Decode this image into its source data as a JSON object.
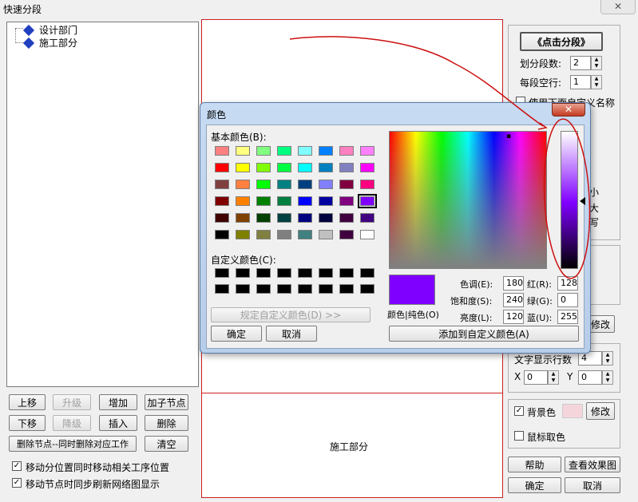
{
  "window": {
    "title": "快速分段"
  },
  "tree": {
    "items": [
      "设计部门",
      "施工部分"
    ]
  },
  "left_buttons": {
    "up": "上移",
    "promote": "升级",
    "add": "增加",
    "add_child": "加子节点",
    "down": "下移",
    "demote": "降级",
    "insert": "插入",
    "delete": "删除",
    "delete_node": "删除节点--同时删除对应工作",
    "clear": "清空"
  },
  "left_checks": {
    "move_pos": "移动分位置同时移动相关工序位置",
    "refresh": "移动节点时同步刷新网络图显示"
  },
  "center": {
    "bottom_label": "施工部分"
  },
  "right": {
    "click_segment": "《点击分段》",
    "seg_count_label": "划分段数:",
    "seg_count": "2",
    "blank_rows_label": "每段空行:",
    "blank_rows": "1",
    "use_custom_name": "使用下面自定义名称",
    "modify_partial": "修改",
    "text_rows_label": "文字显示行数",
    "text_rows": "4",
    "x_label": "X",
    "x_val": "0",
    "y_label": "Y",
    "y_val": "0",
    "bg_color_label": "背景色",
    "bg_modify": "修改",
    "mouse_pick": "鼠标取色",
    "help": "帮助",
    "view_effect": "查看效果图",
    "ok": "确定",
    "cancel": "取消",
    "partial_chars": [
      "小",
      "大",
      "写"
    ]
  },
  "color_dialog": {
    "title": "颜色",
    "basic_label": "基本颜色(B):",
    "custom_label": "自定义颜色(C):",
    "define_custom": "规定自定义颜色(D) >>",
    "ok": "确定",
    "cancel": "取消",
    "color_solid": "颜色|纯色(O)",
    "hue_label": "色调(E):",
    "hue": "180",
    "sat_label": "饱和度(S):",
    "sat": "240",
    "lum_label": "亮度(L):",
    "lum": "120",
    "red_label": "红(R):",
    "red": "128",
    "green_label": "绿(G):",
    "green": "0",
    "blue_label": "蓝(U):",
    "blue": "255",
    "add_custom": "添加到自定义颜色(A)",
    "basic_colors": [
      "#ff8080",
      "#ffff80",
      "#80ff80",
      "#00ff80",
      "#80ffff",
      "#0080ff",
      "#ff80c0",
      "#ff80ff",
      "#ff0000",
      "#ffff00",
      "#80ff00",
      "#00ff40",
      "#00ffff",
      "#0080c0",
      "#8080c0",
      "#ff00ff",
      "#804040",
      "#ff8040",
      "#00ff00",
      "#008080",
      "#004080",
      "#8080ff",
      "#800040",
      "#ff0080",
      "#800000",
      "#ff8000",
      "#008000",
      "#008040",
      "#0000ff",
      "#0000a0",
      "#800080",
      "#8000ff",
      "#400000",
      "#804000",
      "#004000",
      "#004040",
      "#000080",
      "#000040",
      "#400040",
      "#400080",
      "#000000",
      "#808000",
      "#808040",
      "#808080",
      "#408080",
      "#c0c0c0",
      "#400040",
      "#ffffff"
    ],
    "selected_index": 31,
    "current_color": "#8000ff"
  },
  "colors": {
    "accent_red": "#cc0000",
    "bg_pink": "#f5d5dc"
  }
}
